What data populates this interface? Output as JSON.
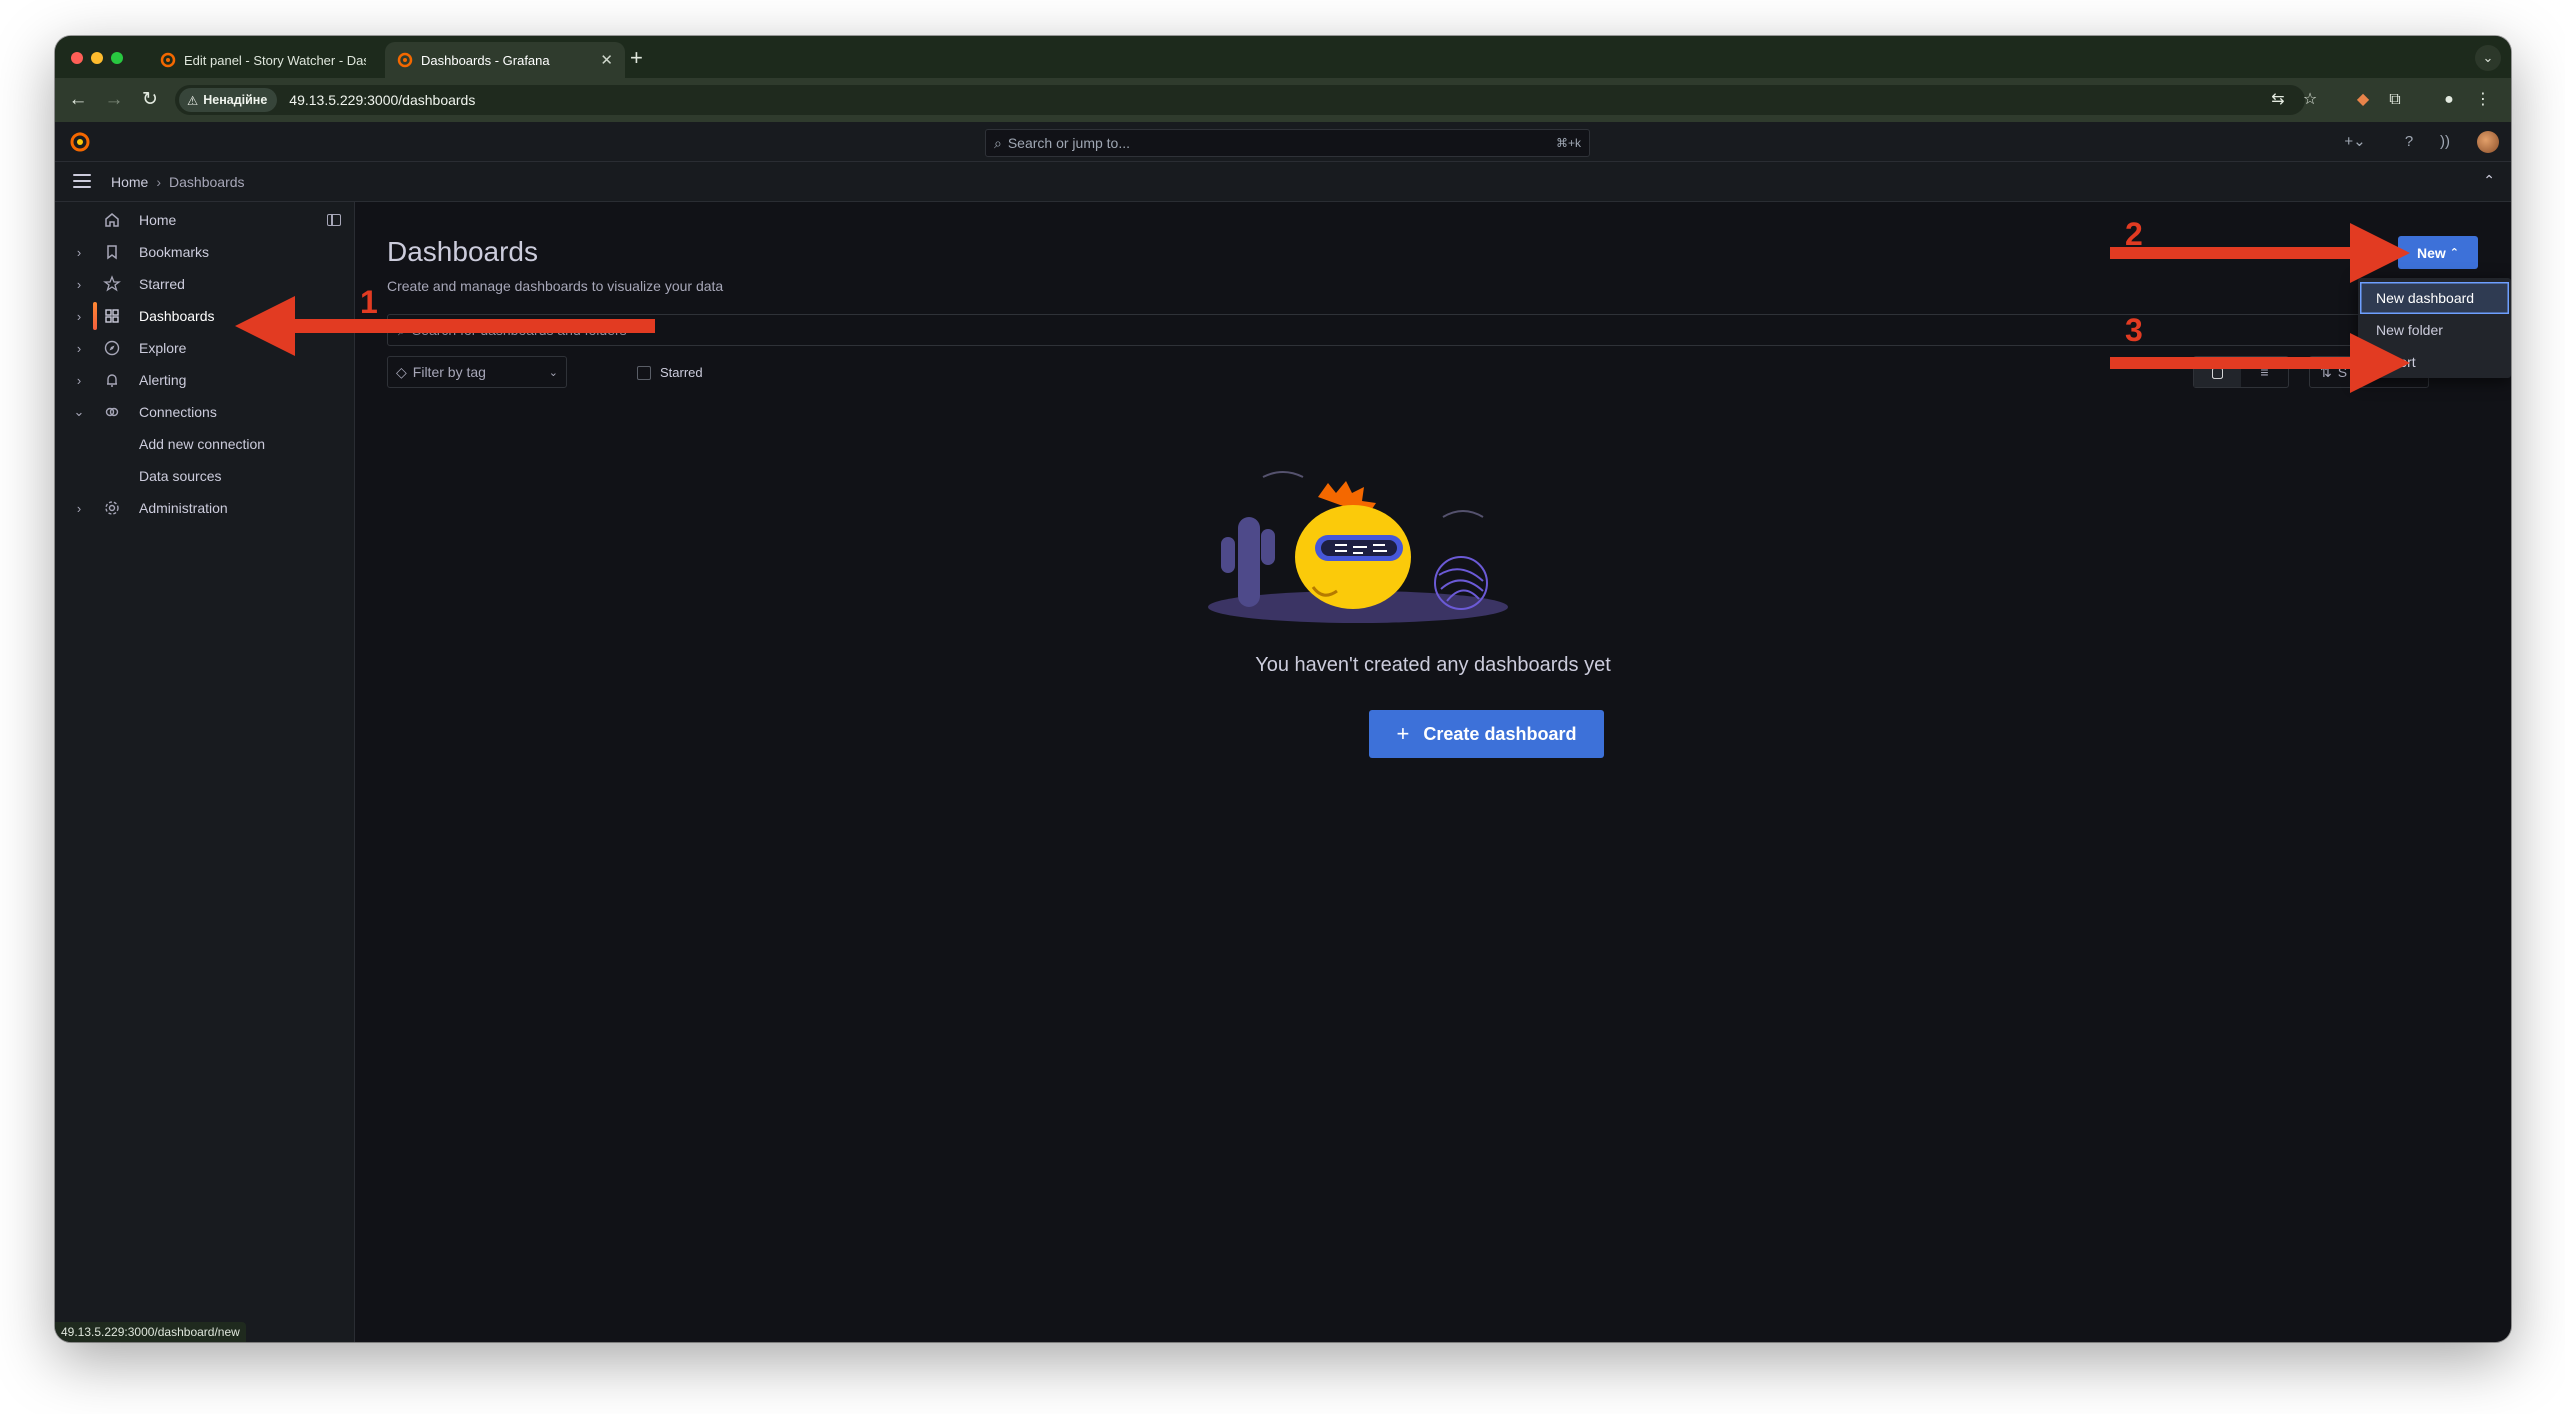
{
  "browser": {
    "tabs": [
      {
        "title": "Edit panel - Story Watcher - Dashboards - Grafana",
        "active": false
      },
      {
        "title": "Dashboards - Grafana",
        "active": true
      }
    ],
    "security_label": "Ненадійне",
    "url": "49.13.5.229:3000/dashboards",
    "status_url": "49.13.5.229:3000/dashboard/new"
  },
  "grafana": {
    "search": {
      "placeholder": "Search or jump to...",
      "shortcut": "⌘+k"
    },
    "breadcrumb": {
      "home": "Home",
      "current": "Dashboards"
    }
  },
  "sidebar": {
    "items": [
      {
        "label": "Home",
        "icon": "home-icon",
        "chevron": ""
      },
      {
        "label": "Bookmarks",
        "icon": "bookmark-icon",
        "chevron": "›"
      },
      {
        "label": "Starred",
        "icon": "star-icon",
        "chevron": "›"
      },
      {
        "label": "Dashboards",
        "icon": "apps-icon",
        "chevron": "›",
        "active": true
      },
      {
        "label": "Explore",
        "icon": "compass-icon",
        "chevron": "›"
      },
      {
        "label": "Alerting",
        "icon": "bell-icon",
        "chevron": "›"
      },
      {
        "label": "Connections",
        "icon": "link-icon",
        "chevron": "⌄"
      },
      {
        "label": "Add new connection",
        "icon": "",
        "chevron": ""
      },
      {
        "label": "Data sources",
        "icon": "",
        "chevron": ""
      },
      {
        "label": "Administration",
        "icon": "cog-icon",
        "chevron": "›"
      }
    ]
  },
  "main": {
    "title": "Dashboards",
    "subtitle": "Create and manage dashboards to visualize your data",
    "search_placeholder": "Search for dashboards and folders",
    "filter_tag_label": "Filter by tag",
    "starred_label": "Starred",
    "sort_label": "S",
    "empty_text": "You haven't created any dashboards yet",
    "create_button": "Create dashboard"
  },
  "new_menu": {
    "button_label": "New",
    "items": [
      "New dashboard",
      "New folder",
      "Import"
    ]
  },
  "annotations": {
    "step1": "1",
    "step2": "2",
    "step3": "3",
    "arrow_color": "#e23b22"
  },
  "colors": {
    "accent_blue": "#3d71d9",
    "grafana_orange": "#f55f3e",
    "background": "#111217"
  }
}
